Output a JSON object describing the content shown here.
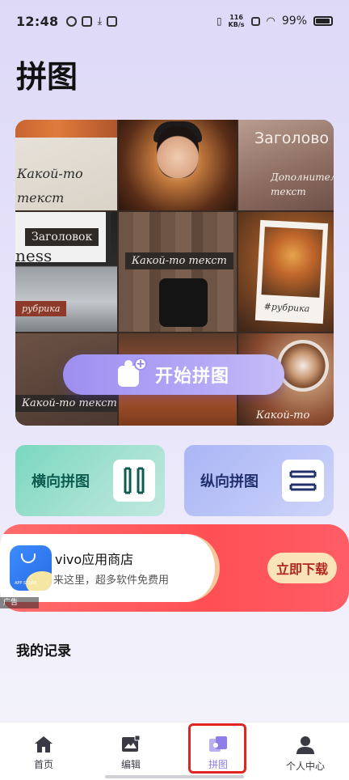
{
  "status_bar": {
    "time": "12:48",
    "net_speed_value": "116",
    "net_speed_unit": "KB/s",
    "battery": "99%"
  },
  "page": {
    "title": "拼图"
  },
  "hero": {
    "overlay_texts": {
      "t1": "Какой-то\nтекст",
      "t3_title": "Заголово",
      "t3_sub": "Дополнительны\nтекст",
      "t4_heading": "Заголовок",
      "t4_partial": "ness",
      "t4_tag": "рубрика",
      "t5": "Какой-то текст",
      "t6": "#рубрика",
      "t7": "Какой-то текст",
      "t9": "Какой-то"
    },
    "start_button_label": "开始拼图"
  },
  "cards": {
    "horizontal_label": "横向拼图",
    "vertical_label": "纵向拼图"
  },
  "ad": {
    "title": "vivo应用商店",
    "subtitle": "来这里，超多软件免费用",
    "button_label": "立即下载",
    "tag": "广告",
    "logo_text": "APP STORE"
  },
  "records": {
    "title": "我的记录"
  },
  "tabbar": {
    "items": [
      {
        "label": "首页",
        "icon": "home-icon"
      },
      {
        "label": "编辑",
        "icon": "image-edit-icon"
      },
      {
        "label": "拼图",
        "icon": "puzzle-icon"
      },
      {
        "label": "个人中心",
        "icon": "person-icon"
      }
    ],
    "active_color": "#8f7ee9"
  },
  "colors": {
    "accent_purple": "#9e8ff0",
    "highlight_red": "#e02525",
    "ad_red": "#ff4f55"
  }
}
